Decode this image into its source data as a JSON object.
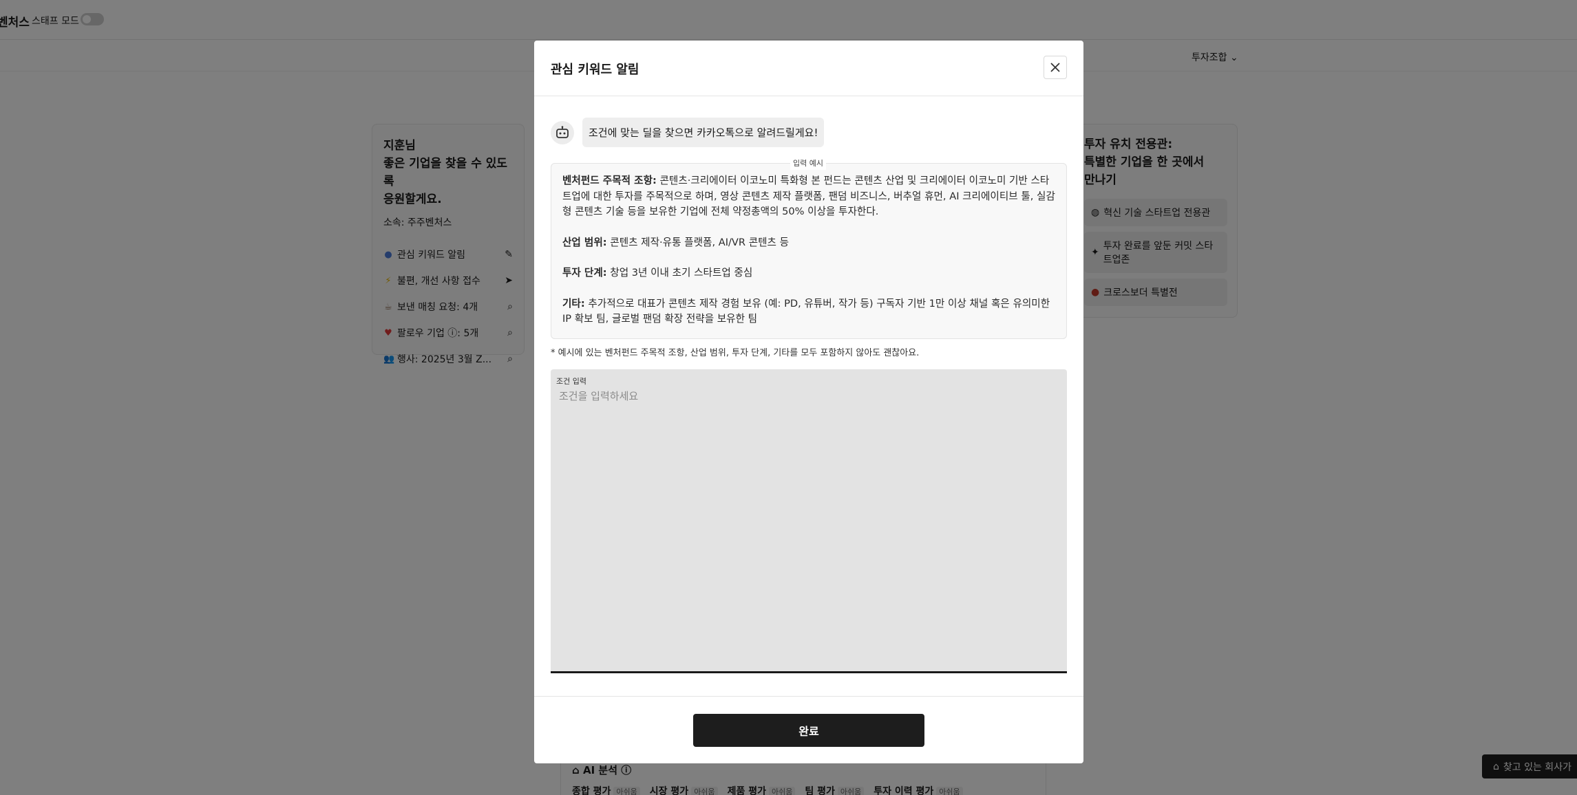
{
  "topbar": {
    "brand": "벤처스",
    "staff_mode_label": "스태프 모드"
  },
  "subnav": {
    "fund_menu_label": "투자조합"
  },
  "left_card": {
    "title_line1": "지훈님",
    "title_line2": "좋은 기업을 찾을 수 있도록",
    "title_line3": "응원할게요.",
    "affiliation": "소속: 주주벤처스",
    "items": [
      {
        "label": "관심 키워드 알림",
        "icon": "keyword-icon",
        "action": "edit-icon"
      },
      {
        "label": "불편, 개선 사항 접수",
        "icon": "lightning-icon",
        "action": "send-icon"
      },
      {
        "label": "보낸 매칭 요청: 4개",
        "icon": "coffee-icon",
        "action": "search-icon"
      },
      {
        "label": "팔로우 기업 ⓘ: 5개",
        "icon": "heart-icon",
        "action": "search-icon"
      },
      {
        "label": "행사: 2025년 3월 Z...",
        "icon": "people-icon",
        "action": "search-icon"
      }
    ]
  },
  "right_card": {
    "title_line1": "투자 유치 전용관:",
    "title_line2": "특별한 기업을 한 곳에서",
    "title_line3": "만나기",
    "items": [
      {
        "label": "혁신 기술 스타트업 전용관"
      },
      {
        "label": "투자 완료를 앞둔 커밋 스타트업존"
      },
      {
        "label": "크로스보더 특별전"
      }
    ]
  },
  "ai_section": {
    "title": "AI 분석",
    "tags": [
      {
        "label": "종합 평가",
        "badge": "아쉬움"
      },
      {
        "label": "시장 평가",
        "badge": "아쉬움"
      },
      {
        "label": "제품 평가",
        "badge": "아쉬움"
      },
      {
        "label": "팀 평가",
        "badge": "아쉬움"
      },
      {
        "label": "투자 이력 평가",
        "badge": "아쉬움"
      }
    ]
  },
  "floating_button": {
    "label": "찾고 있는 회사가"
  },
  "modal": {
    "title": "관심 키워드 알림",
    "bot_message": "조건에 맞는 딜을 찾으면 카카오톡으로 알려드릴게요!",
    "example_label": "입력 예시",
    "example": {
      "p1_bold": "벤처펀드 주목적 조항:",
      "p1_text": " 콘텐츠·크리에이터 이코노미 특화형 본 펀드는 콘텐츠 산업 및 크리에이터 이코노미 기반 스타트업에 대한 투자를 주목적으로 하며, 영상 콘텐츠 제작 플랫폼, 팬덤 비즈니스, 버추얼 휴먼, AI 크리에이티브 툴, 실감형 콘텐츠 기술 등을 보유한 기업에 전체 약정총액의 50% 이상을 투자한다.",
      "p2_bold": "산업 범위:",
      "p2_text": " 콘텐츠 제작·유통 플랫폼, AI/VR 콘텐츠 등",
      "p3_bold": "투자 단계:",
      "p3_text": " 창업 3년 이내 초기 스타트업 중심",
      "p4_bold": "기타:",
      "p4_text": " 추가적으로 대표가 콘텐츠 제작 경험 보유 (예: PD, 유튜버, 작가 등) 구독자 기반 1만 이상 채널 혹은 유의미한 IP 확보 팀, 글로벌 팬덤 확장 전략을 보유한 팀"
    },
    "note": "* 예시에 있는 벤처펀드 주목적 조항, 산업 범위, 투자 단계, 기타를 모두 포함하지 않아도 괜찮아요.",
    "input_label": "조건 입력",
    "input_placeholder": "조건을 입력하세요",
    "input_value": "",
    "done_button": "완료"
  }
}
